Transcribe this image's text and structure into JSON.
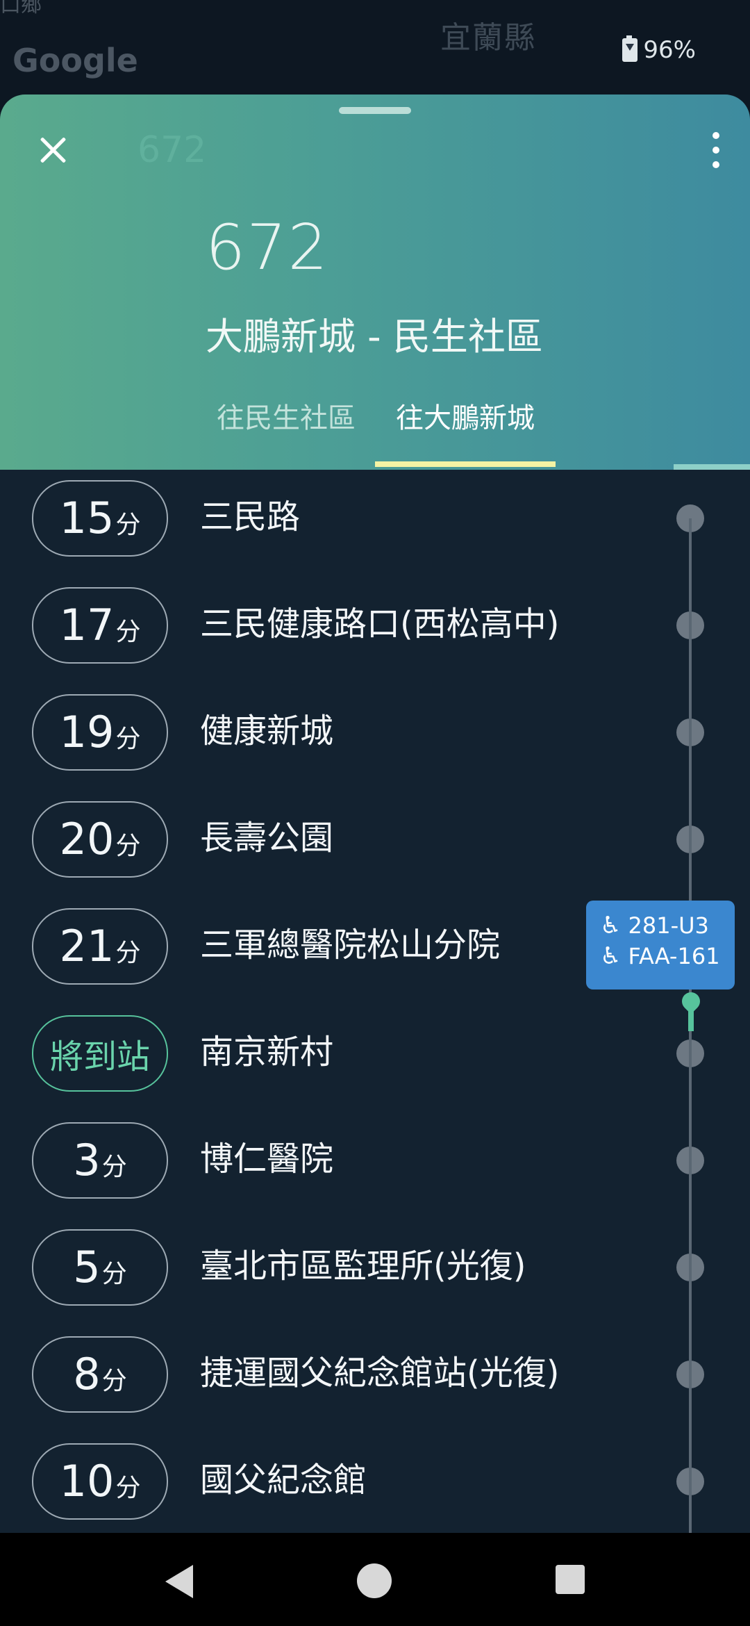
{
  "map": {
    "top_label": "口鄉",
    "county_label": "宜蘭縣",
    "logo": "Google"
  },
  "status": {
    "battery": "96%"
  },
  "header": {
    "faded_title": "672",
    "route_number": "672",
    "route_name": "大鵬新城 - 民生社區",
    "tabs": [
      {
        "label": "往民生社區",
        "selected": false
      },
      {
        "label": "往大鵬新城",
        "selected": true
      }
    ]
  },
  "stops": [
    {
      "time_num": "15",
      "time_unit": "分",
      "name": "三民路"
    },
    {
      "time_num": "17",
      "time_unit": "分",
      "name": "三民健康路口(西松高中)"
    },
    {
      "time_num": "19",
      "time_unit": "分",
      "name": "健康新城"
    },
    {
      "time_num": "20",
      "time_unit": "分",
      "name": "長壽公園"
    },
    {
      "time_num": "21",
      "time_unit": "分",
      "name": "三軍總醫院松山分院"
    },
    {
      "time_status": "將到站",
      "name": "南京新村"
    },
    {
      "time_num": "3",
      "time_unit": "分",
      "name": "博仁醫院"
    },
    {
      "time_num": "5",
      "time_unit": "分",
      "name": "臺北市區監理所(光復)"
    },
    {
      "time_num": "8",
      "time_unit": "分",
      "name": "捷運國父紀念館站(光復)"
    },
    {
      "time_num": "10",
      "time_unit": "分",
      "name": "國父紀念館"
    }
  ],
  "bus_tag": {
    "plates": [
      "281-U3",
      "FAA-161"
    ],
    "icon": "wheelchair-icon"
  },
  "colors": {
    "accent": "#57c39c",
    "tab_underline": "#f4f3a4",
    "bus_tag": "#3b87cf"
  }
}
